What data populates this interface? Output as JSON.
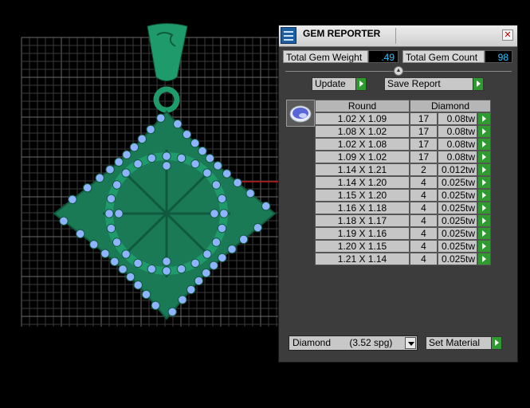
{
  "panel": {
    "title": "GEM REPORTER",
    "close_glyph": "✕",
    "total_weight_label": "Total Gem Weight",
    "total_weight_value": ".49",
    "total_count_label": "Total Gem Count",
    "total_count_value": "98",
    "update_label": "Update",
    "save_report_label": "Save Report",
    "collapse_glyph": "▲"
  },
  "table": {
    "header_size": "Round",
    "header_material": "Diamond",
    "rows": [
      {
        "size": "1.02 X 1.09",
        "count": "17",
        "weight": "0.08tw"
      },
      {
        "size": "1.08 X 1.02",
        "count": "17",
        "weight": "0.08tw"
      },
      {
        "size": "1.02 X 1.08",
        "count": "17",
        "weight": "0.08tw"
      },
      {
        "size": "1.09 X 1.02",
        "count": "17",
        "weight": "0.08tw"
      },
      {
        "size": "1.14 X 1.21",
        "count": "2",
        "weight": "0.012tw"
      },
      {
        "size": "1.14 X 1.20",
        "count": "4",
        "weight": "0.025tw"
      },
      {
        "size": "1.15 X 1.20",
        "count": "4",
        "weight": "0.025tw"
      },
      {
        "size": "1.16 X 1.18",
        "count": "4",
        "weight": "0.025tw"
      },
      {
        "size": "1.18 X 1.17",
        "count": "4",
        "weight": "0.025tw"
      },
      {
        "size": "1.19 X 1.16",
        "count": "4",
        "weight": "0.025tw"
      },
      {
        "size": "1.20 X 1.15",
        "count": "4",
        "weight": "0.025tw"
      },
      {
        "size": "1.21 X 1.14",
        "count": "4",
        "weight": "0.025tw"
      }
    ]
  },
  "material": {
    "selected": "Diamond       (3.52 spg)",
    "set_label": "Set Material"
  },
  "colors": {
    "metal": "#1f9a6a",
    "metal_dark": "#0f5a3e",
    "gem": "#8fb4ff",
    "grid_minor": "#3a3a3a",
    "grid_major": "#6a6a6a",
    "accent_value": "#28c6ff",
    "go_button": "#2f9a2f"
  },
  "icons": [
    "gem-reporter-app-icon",
    "close-icon",
    "collapse-arrow-icon",
    "play-arrow-icon",
    "round-gem-icon",
    "dropdown-arrow-icon"
  ]
}
